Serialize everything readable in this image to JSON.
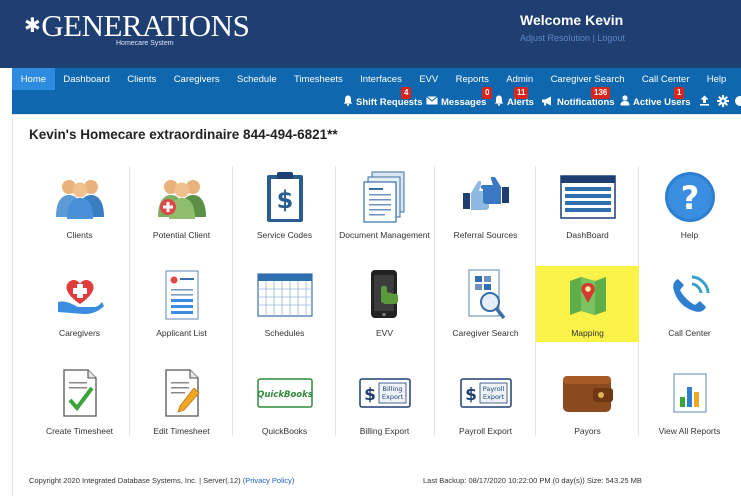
{
  "header": {
    "logo_text": "GENERATIONS",
    "logo_sub": "Homecare System",
    "welcome": "Welcome Kevin",
    "links": [
      "Adjust Resolution",
      "|",
      "Logout"
    ]
  },
  "nav": [
    "Home",
    "Dashboard",
    "Clients",
    "Caregivers",
    "Schedule",
    "Timesheets",
    "Interfaces",
    "EVV",
    "Reports",
    "Admin",
    "Caregiver Search",
    "Call Center",
    "Help"
  ],
  "subbar": {
    "shift_requests": {
      "label": "Shift Requests",
      "count": "4"
    },
    "messages": {
      "label": "Messages",
      "count": "0"
    },
    "alerts": {
      "label": "Alerts",
      "count": "11"
    },
    "notifications": {
      "label": "Notifications",
      "count": "136"
    },
    "active_users": {
      "label": "Active Users",
      "count": "1"
    }
  },
  "agency_title": "Kevin's Homecare extraordinaire 844-494-6821**",
  "tiles": [
    {
      "label": "Clients",
      "icon": "clients-icon"
    },
    {
      "label": "Potential Client",
      "icon": "potential-client-icon"
    },
    {
      "label": "Service Codes",
      "icon": "service-codes-icon"
    },
    {
      "label": "Document Management",
      "icon": "document-management-icon"
    },
    {
      "label": "Referral Sources",
      "icon": "referral-sources-icon"
    },
    {
      "label": "DashBoard",
      "icon": "dashboard-icon"
    },
    {
      "label": "Help",
      "icon": "help-icon"
    },
    {
      "label": "Caregivers",
      "icon": "caregivers-icon"
    },
    {
      "label": "Applicant List",
      "icon": "applicant-list-icon"
    },
    {
      "label": "Schedules",
      "icon": "schedules-icon"
    },
    {
      "label": "EVV",
      "icon": "evv-icon"
    },
    {
      "label": "Caregiver Search",
      "icon": "caregiver-search-icon"
    },
    {
      "label": "Mapping",
      "icon": "mapping-icon"
    },
    {
      "label": "Call Center",
      "icon": "call-center-icon"
    },
    {
      "label": "Create Timesheet",
      "icon": "create-timesheet-icon"
    },
    {
      "label": "Edit Timesheet",
      "icon": "edit-timesheet-icon"
    },
    {
      "label": "QuickBooks",
      "icon": "quickbooks-icon"
    },
    {
      "label": "Billing Export",
      "icon": "billing-export-icon"
    },
    {
      "label": "Payroll Export",
      "icon": "payroll-export-icon"
    },
    {
      "label": "Payors",
      "icon": "payors-icon"
    },
    {
      "label": "View All Reports",
      "icon": "view-all-reports-icon"
    }
  ],
  "icon_text": {
    "quickbooks": "QuickBooks",
    "billing": "Billing",
    "payroll": "Payroll",
    "export": "Export"
  },
  "footer": {
    "copyright": "Copyright 2020 Integrated Database Systems, Inc. | Server(.12)",
    "privacy": "(Privacy Policy)",
    "backup": "Last Backup: 08/17/2020 10:22:00 PM (0 day(s)) Size: 543.25 MB"
  },
  "colors": {
    "header_bg": "#1f3f73",
    "nav_bg": "#0f67b0",
    "nav_active": "#2f8be0",
    "badge": "#d9261c",
    "highlight": "#fbf34a"
  }
}
